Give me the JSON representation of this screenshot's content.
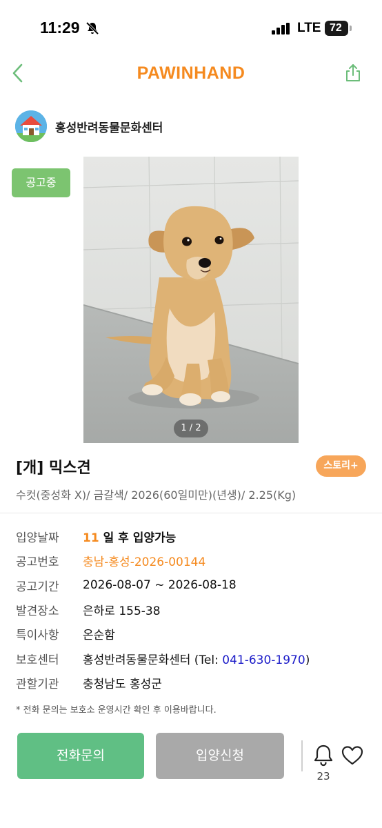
{
  "status_bar": {
    "time": "11:29",
    "network": "LTE",
    "battery": "72"
  },
  "header": {
    "logo": "PAWINHAND",
    "icons": {
      "back": "chevron-left-icon",
      "share": "share-icon"
    }
  },
  "shelter": {
    "name": "홍성반려동물문화센터",
    "avatar_icon": "shelter-house-icon"
  },
  "badge": "공고중",
  "photo": {
    "pager": "1 / 2"
  },
  "animal": {
    "title": "[개] 믹스견",
    "story_label": "스토리+",
    "subtitle": "수컷(중성화 X)/ 금갈색/ 2026(60일미만)(년생)/ 2.25(Kg)"
  },
  "details": {
    "adopt_date": {
      "label": "입양날짜",
      "days": "11",
      "suffix": "일 후 입양가능"
    },
    "notice_no": {
      "label": "공고번호",
      "value": "충남-홍성-2026-00144"
    },
    "period": {
      "label": "공고기간",
      "value": "2026-08-07 ~ 2026-08-18"
    },
    "found_place": {
      "label": "발견장소",
      "value": "은하로 155-38"
    },
    "special": {
      "label": "특이사항",
      "value": "온순함"
    },
    "center": {
      "label": "보호센터",
      "name": "홍성반려동물문화센터 (Tel: ",
      "tel": "041-630-1970",
      "close": ")"
    },
    "authority": {
      "label": "관할기관",
      "value": "충청남도 홍성군"
    }
  },
  "notice": "* 전화 문의는 보호소 운영시간 확인 후 이용바랍니다.",
  "bottom": {
    "call_label": "전화문의",
    "adopt_label": "입양신청",
    "alarm_count": "23"
  },
  "colors": {
    "brand": "#f58a1f",
    "green": "#60bf84",
    "badge_green": "#7cc470",
    "story": "#f7a65a",
    "disabled": "#a9a9a9",
    "link": "#1a1ac8"
  }
}
